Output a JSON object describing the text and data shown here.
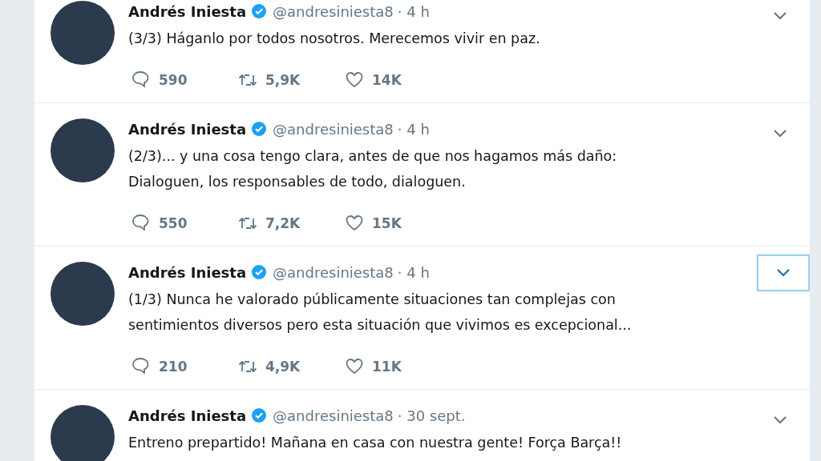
{
  "tweets": [
    {
      "name": "Andrés Iniesta",
      "handle": "@andresiniesta8",
      "time": "· 4 h",
      "lines": [
        "(3/3) Háganlo por todos nosotros. Merecemos vivir en paz."
      ],
      "replies": "590",
      "retweets": "5,9K",
      "likes": "14K",
      "menu_focused": false
    },
    {
      "name": "Andrés Iniesta",
      "handle": "@andresiniesta8",
      "time": "· 4 h",
      "lines": [
        "(2/3)... y una cosa tengo clara, antes de que nos hagamos más daño:",
        "Dialoguen, los responsables de todo, dialoguen."
      ],
      "replies": "550",
      "retweets": "7,2K",
      "likes": "15K",
      "menu_focused": false
    },
    {
      "name": "Andrés Iniesta",
      "handle": "@andresiniesta8",
      "time": "· 4 h",
      "lines": [
        "(1/3) Nunca he valorado públicamente situaciones tan complejas con",
        "sentimientos diversos pero esta situación que vivimos es excepcional..."
      ],
      "replies": "210",
      "retweets": "4,9K",
      "likes": "11K",
      "menu_focused": true
    },
    {
      "name": "Andrés Iniesta",
      "handle": "@andresiniesta8",
      "time": "· 30 sept.",
      "lines": [
        "Entreno prepartido! Mañana en casa con nuestra gente! Força Barça!!"
      ],
      "menu_focused": false
    }
  ]
}
